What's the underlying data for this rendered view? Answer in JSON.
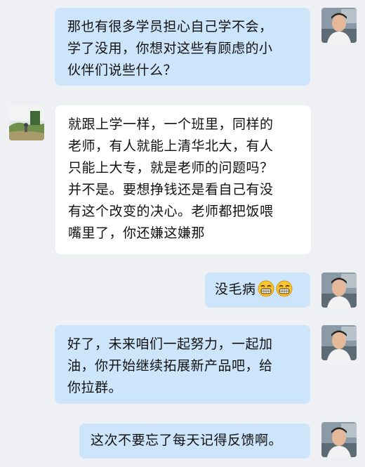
{
  "messages": [
    {
      "sender": "self",
      "lines": [
        "那也有很多学员担心自己学不会，",
        "学了没用，你想对这些有顾虑的小",
        "伙伴们说些什么？"
      ]
    },
    {
      "sender": "other",
      "lines": [
        "就跟上学一样，一个班里，同样的",
        "老师，有人就能上清华北大，有人",
        "只能上大专，就是老师的问题吗？",
        "并不是。要想挣钱还是看自己有没",
        "有这个改变的决心。老师都把饭喂",
        "嘴里了，你还嫌这嫌那"
      ]
    },
    {
      "sender": "self",
      "lines": [
        "没毛病"
      ],
      "emojis": [
        "grin-emoji",
        "grin-emoji"
      ]
    },
    {
      "sender": "self",
      "lines": [
        "好了，未来咱们一起努力，一起加",
        "油，你开始继续拓展新产品吧，给",
        "你拉群。"
      ]
    },
    {
      "sender": "self",
      "lines": [
        "这次不要忘了每天记得反馈啊。"
      ]
    }
  ],
  "colors": {
    "background": "#eef0f3",
    "outgoing_bubble": "#cde5fb",
    "incoming_bubble": "#ffffff",
    "text": "#111111"
  }
}
